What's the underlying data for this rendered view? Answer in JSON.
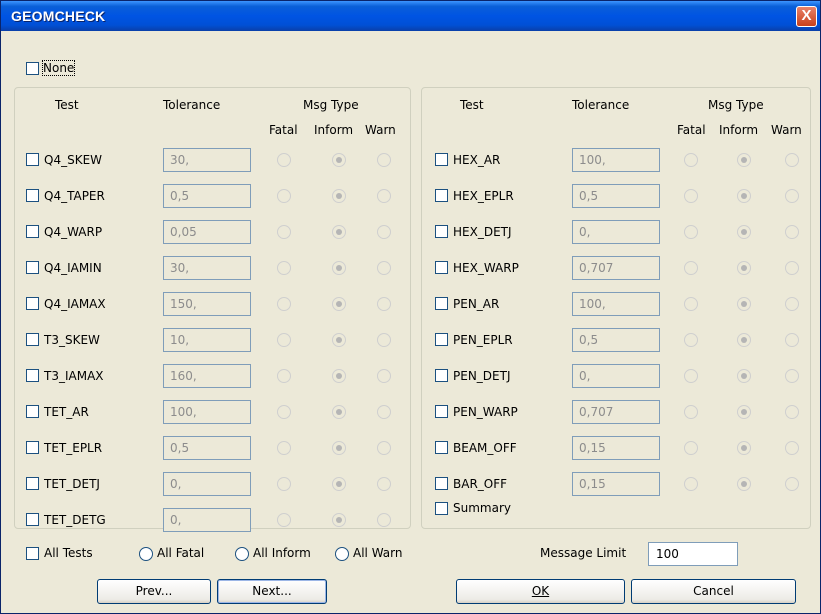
{
  "window": {
    "title": "GEOMCHECK",
    "close_label": "X"
  },
  "none_label": "None",
  "headers": {
    "test": "Test",
    "tolerance": "Tolerance",
    "msg_type": "Msg Type",
    "fatal": "Fatal",
    "inform": "Inform",
    "warn": "Warn"
  },
  "left_tests": [
    {
      "name": "Q4_SKEW",
      "tolerance": "30,"
    },
    {
      "name": "Q4_TAPER",
      "tolerance": "0,5"
    },
    {
      "name": "Q4_WARP",
      "tolerance": "0,05"
    },
    {
      "name": "Q4_IAMIN",
      "tolerance": "30,"
    },
    {
      "name": "Q4_IAMAX",
      "tolerance": "150,"
    },
    {
      "name": "T3_SKEW",
      "tolerance": "10,"
    },
    {
      "name": "T3_IAMAX",
      "tolerance": "160,"
    },
    {
      "name": "TET_AR",
      "tolerance": "100,"
    },
    {
      "name": "TET_EPLR",
      "tolerance": "0,5"
    },
    {
      "name": "TET_DETJ",
      "tolerance": "0,"
    },
    {
      "name": "TET_DETG",
      "tolerance": "0,"
    }
  ],
  "right_tests": [
    {
      "name": "HEX_AR",
      "tolerance": "100,"
    },
    {
      "name": "HEX_EPLR",
      "tolerance": "0,5"
    },
    {
      "name": "HEX_DETJ",
      "tolerance": "0,"
    },
    {
      "name": "HEX_WARP",
      "tolerance": "0,707"
    },
    {
      "name": "PEN_AR",
      "tolerance": "100,"
    },
    {
      "name": "PEN_EPLR",
      "tolerance": "0,5"
    },
    {
      "name": "PEN_DETJ",
      "tolerance": "0,"
    },
    {
      "name": "PEN_WARP",
      "tolerance": "0,707"
    },
    {
      "name": "BEAM_OFF",
      "tolerance": "0,15"
    },
    {
      "name": "BAR_OFF",
      "tolerance": "0,15"
    }
  ],
  "summary_label": "Summary",
  "bottom": {
    "all_tests": "All Tests",
    "all_fatal": "All Fatal",
    "all_inform": "All Inform",
    "all_warn": "All Warn",
    "message_limit_label": "Message Limit",
    "message_limit_value": "100"
  },
  "buttons": {
    "prev": "Prev...",
    "next": "Next...",
    "ok": "OK",
    "cancel": "Cancel"
  },
  "selected_msg_type": "Inform"
}
